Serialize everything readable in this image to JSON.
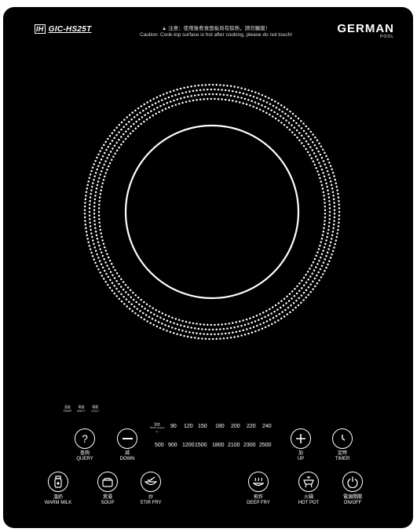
{
  "header": {
    "badge": "IH",
    "model": "GIC-HS25T",
    "warning_zh": "▲ 注意：使用後煮食面板尚有餘熱，請勿觸摸！",
    "warning_en": "Caution: Cook-top surface is hot after cooking, please do not touch!",
    "brand_main": "GERMAN",
    "brand_sub": "POOL"
  },
  "indicators": [
    {
      "zh": "溫度",
      "en": "TEMP."
    },
    {
      "zh": "電量",
      "en": "WATT"
    },
    {
      "zh": "電壓",
      "en": "VOLT"
    }
  ],
  "temp_row": {
    "label_zh": "溫度",
    "label_en": "TEMP (degree C)",
    "values": [
      "90",
      "120",
      "150",
      "180",
      "200",
      "220",
      "240"
    ]
  },
  "watt_row": {
    "values": [
      "500",
      "900",
      "1200",
      "1500",
      "1800",
      "2100",
      "2300",
      "2500"
    ]
  },
  "controls": {
    "query": {
      "zh": "查詢",
      "en": "QUERY",
      "icon": "question-icon"
    },
    "down": {
      "zh": "減",
      "en": "DOWN",
      "icon": "minus-icon"
    },
    "up": {
      "zh": "加",
      "en": "UP",
      "icon": "plus-icon"
    },
    "timer": {
      "zh": "定時",
      "en": "TIMER",
      "icon": "clock-icon"
    }
  },
  "modes": {
    "warm_milk": {
      "zh": "溫奶",
      "en": "WARM MILK",
      "icon": "bottle-icon"
    },
    "soup": {
      "zh": "煲湯",
      "en": "SOUP",
      "icon": "pot-icon"
    },
    "stir_fry": {
      "zh": "炒",
      "en": "STIR FRY",
      "icon": "wok-icon"
    },
    "deep_fry": {
      "zh": "煎炸",
      "en": "DEEP FRY",
      "icon": "fryer-icon"
    },
    "hot_pot": {
      "zh": "火鍋",
      "en": "HOT POT",
      "icon": "hotpot-icon"
    },
    "power": {
      "zh": "電源開關",
      "en": "ON/OFF",
      "icon": "power-icon"
    }
  },
  "colors": {
    "panel": "#000000",
    "text": "#ffffff"
  }
}
